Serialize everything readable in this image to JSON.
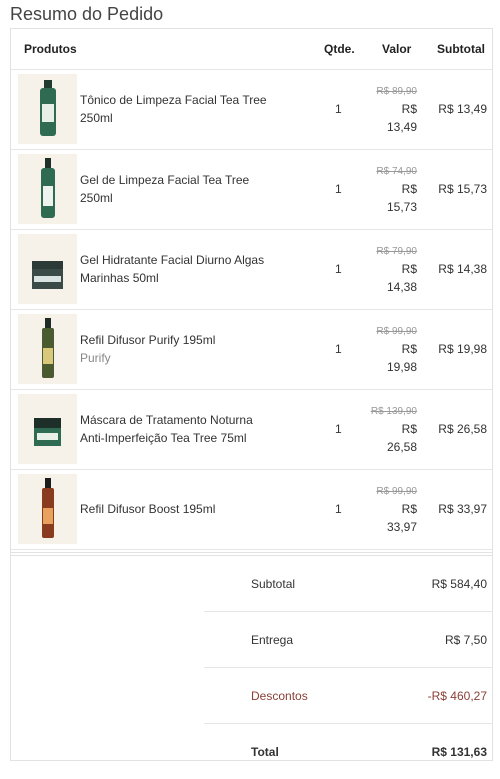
{
  "title": "Resumo do Pedido",
  "headers": {
    "products": "Produtos",
    "qty": "Qtde.",
    "value": "Valor",
    "subtotal": "Subtotal"
  },
  "items": [
    {
      "name": "Tônico de Limpeza Facial Tea Tree 250ml",
      "variant": "",
      "qty": "1",
      "old_price": "R$ 89,90",
      "price_line1": "R$",
      "price_line2": "13,49",
      "subtotal": "R$ 13,49",
      "icon": "green-bottle-icon"
    },
    {
      "name": "Gel de Limpeza Facial Tea Tree 250ml",
      "variant": "",
      "qty": "1",
      "old_price": "R$ 74,90",
      "price_line1": "R$",
      "price_line2": "15,73",
      "subtotal": "R$ 15,73",
      "icon": "green-pump-bottle-icon"
    },
    {
      "name": "Gel Hidratante Facial Diurno Algas Marinhas 50ml",
      "variant": "",
      "qty": "1",
      "old_price": "R$ 79,90",
      "price_line1": "R$",
      "price_line2": "14,38",
      "subtotal": "R$ 14,38",
      "icon": "jar-icon"
    },
    {
      "name": "Refil Difusor Purify 195ml",
      "variant": "Purify",
      "qty": "1",
      "old_price": "R$ 99,90",
      "price_line1": "R$",
      "price_line2": "19,98",
      "subtotal": "R$ 19,98",
      "icon": "diffuser-bottle-icon"
    },
    {
      "name": "Máscara de Tratamento Noturna Anti-Imperfeição Tea Tree 75ml",
      "variant": "",
      "qty": "1",
      "old_price": "R$ 139,90",
      "price_line1": "R$",
      "price_line2": "26,58",
      "subtotal": "R$ 26,58",
      "icon": "green-jar-icon"
    },
    {
      "name": "Refil Difusor Boost 195ml",
      "variant": "",
      "qty": "1",
      "old_price": "R$ 99,90",
      "price_line1": "R$",
      "price_line2": "33,97",
      "subtotal": "R$ 33,97",
      "icon": "orange-bottle-icon"
    }
  ],
  "totals": {
    "subtotal_label": "Subtotal",
    "subtotal_value": "R$ 584,40",
    "shipping_label": "Entrega",
    "shipping_value": "R$ 7,50",
    "discount_label": "Descontos",
    "discount_value": "-R$ 460,27",
    "total_label": "Total",
    "total_value": "R$ 131,63"
  },
  "colors": {
    "discount": "#8a3f36",
    "thumb_bg": "#f6f1e9"
  }
}
